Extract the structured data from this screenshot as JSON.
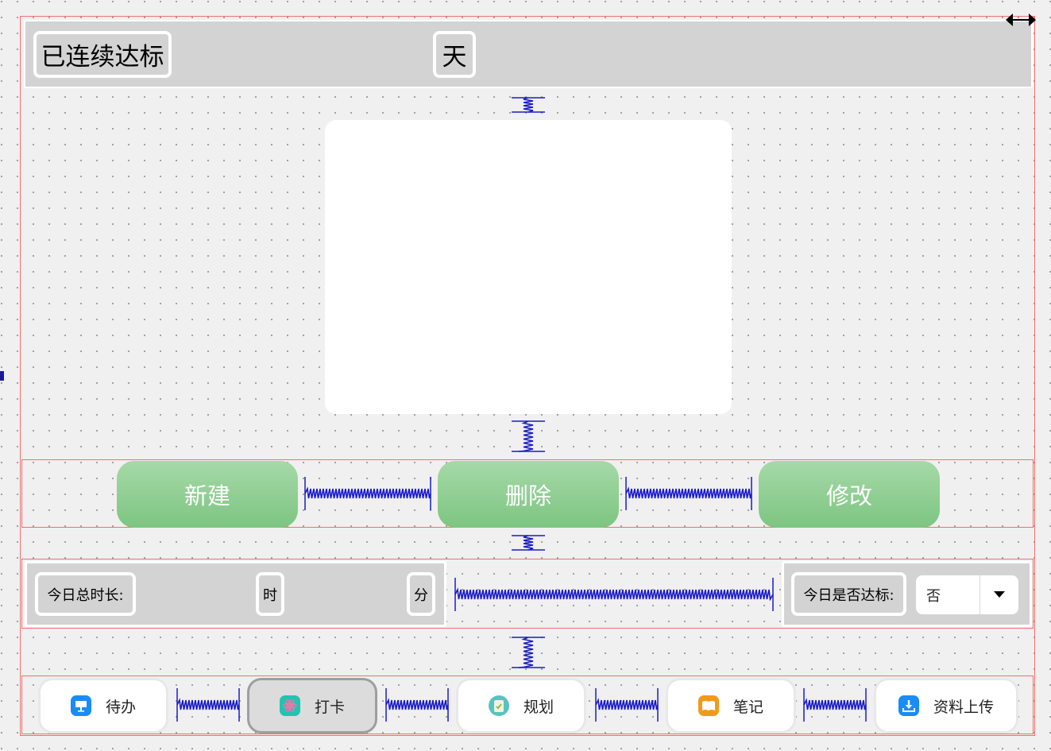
{
  "header": {
    "streak_label": "已连续达标",
    "days_label": "天"
  },
  "actions": {
    "new_label": "新建",
    "delete_label": "删除",
    "edit_label": "修改"
  },
  "stats": {
    "total_time_label": "今日总时长:",
    "hours_label": "时",
    "minutes_label": "分",
    "reached_label": "今日是否达标:",
    "reached_value": "否"
  },
  "nav": {
    "items": [
      {
        "label": "待办",
        "icon": "keynote-board-icon",
        "color": "#1a8cf5"
      },
      {
        "label": "打卡",
        "icon": "atom-icon",
        "color": "#20c4b0",
        "active": true
      },
      {
        "label": "规划",
        "icon": "clipboard-icon",
        "color": "#58c3c0"
      },
      {
        "label": "笔记",
        "icon": "open-book-icon",
        "color": "#f29a18"
      },
      {
        "label": "资料上传",
        "icon": "download-tray-icon",
        "color": "#1a8cf5"
      }
    ]
  },
  "colors": {
    "header_bg": "#d3d3d3",
    "green_button_top": "#a6d9a8",
    "green_button_bottom": "#7dc581",
    "layout_outline": "#f07070",
    "spacer": "#1a1ac8"
  }
}
